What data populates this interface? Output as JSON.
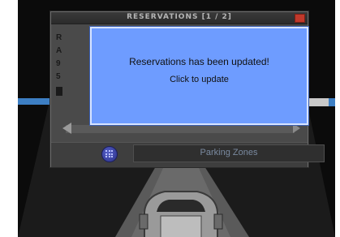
{
  "panel": {
    "title": "RESERVATIONS [1 / 2]",
    "row_letters": [
      "R",
      "A",
      "9",
      "5"
    ]
  },
  "modal": {
    "message": "Reservations has been updated!",
    "action": "Click to update"
  },
  "footer": {
    "zones_label": "Parking Zones"
  },
  "icons": {
    "close": "close-icon",
    "grid": "grid-icon",
    "scroll_left": "arrow-left-icon",
    "scroll_right": "arrow-right-icon"
  },
  "colors": {
    "modal_bg": "#6e9cff",
    "accent_blue": "#3d7fc4",
    "panel_bg": "#4a4a4a",
    "close_red": "#c0392b"
  }
}
